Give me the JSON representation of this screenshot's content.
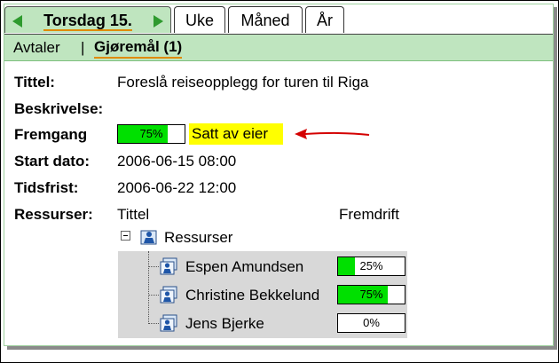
{
  "tabs": {
    "day_label": "Torsdag 15.",
    "week_label": "Uke",
    "month_label": "Måned",
    "year_label": "År"
  },
  "subnav": {
    "avtaler_label": "Avtaler",
    "separator": "|",
    "gjoremal_label": "Gjøremål (1)"
  },
  "task": {
    "title_label": "Tittel:",
    "title_value": "Foreslå reiseopplegg for turen til Riga",
    "description_label": "Beskrivelse:",
    "progress_label": "Fremgang",
    "progress_text": "75%",
    "progress_percent": 75,
    "owner_note": "Satt av eier",
    "start_label": "Start dato:",
    "start_value": "2006-06-15 08:00",
    "deadline_label": "Tidsfrist:",
    "deadline_value": "2006-06-22 12:00",
    "resources_label": "Ressurser:"
  },
  "resources": {
    "col_title": "Tittel",
    "col_progress": "Fremdrift",
    "root_label": "Ressurser",
    "items": [
      {
        "name": "Espen Amundsen",
        "progress_text": "25%",
        "progress_percent": 25
      },
      {
        "name": "Christine Bekkelund",
        "progress_text": "75%",
        "progress_percent": 75
      },
      {
        "name": "Jens Bjerke",
        "progress_text": "0%",
        "progress_percent": 0
      }
    ]
  },
  "colors": {
    "tab_active_bg": "#bfe5bf",
    "progress_fill": "#00e000",
    "highlight": "#ffff00",
    "arrow": "#d40000",
    "underline": "#e08a00"
  }
}
